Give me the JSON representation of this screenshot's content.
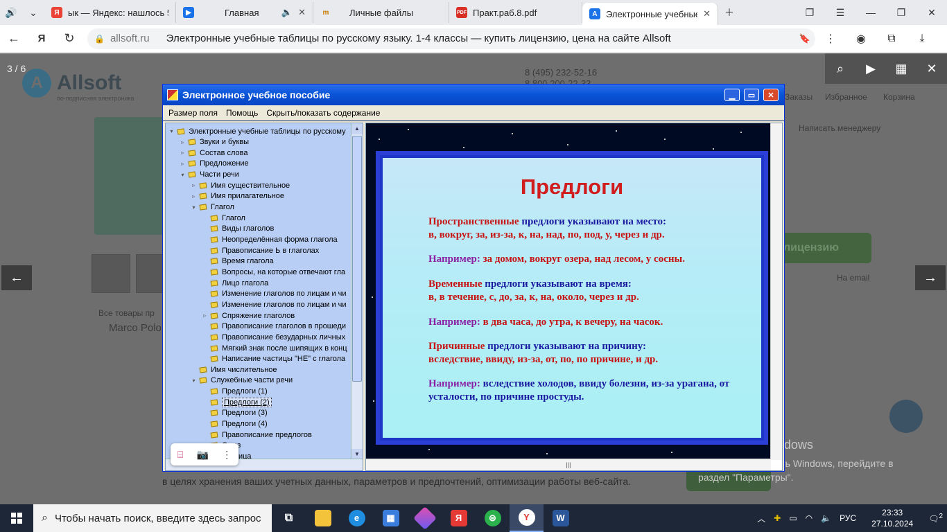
{
  "browser": {
    "tabs": [
      {
        "title": "ык — Яндекс: нашлось 5 т",
        "favicon": "yandex-icon",
        "color": "#ea4335"
      },
      {
        "title": "Главная",
        "favicon": "play-icon",
        "color": "#1a73e8"
      },
      {
        "title": "Личные файлы",
        "favicon": "files-icon",
        "color": "#f4a21a"
      },
      {
        "title": "Практ.раб.8.pdf",
        "favicon": "pdf-icon",
        "color": "#d93025"
      },
      {
        "title": "Электронные учебные",
        "favicon": "allsoft-icon",
        "color": "#1a73e8"
      }
    ],
    "address": {
      "domain": "allsoft.ru",
      "page_title": "Электронные учебные таблицы по русскому языку. 1-4 классы — купить лицензию, цена на сайте Allsoft"
    }
  },
  "background_page": {
    "counter": "3 / 6",
    "logo": "Allsoft",
    "logo_sub": "по-подписная электроника",
    "phone": "8 (495) 232-52-16",
    "phone2": "8 800 200-22-33",
    "top_links": [
      "Заказы",
      "Избранное",
      "Корзина"
    ],
    "write_manager": "Написать менеджеру",
    "buy_button": "лицензию",
    "by_email": "На email",
    "all_products": "Все товары пр",
    "vendor": "Marco Polo",
    "cookie_text": "в целях хранения ваших учетных данных, параметров и предпочтений, оптимизации работы веб-сайта."
  },
  "app": {
    "title": "Электронное учебное пособие",
    "menu": [
      "Размер поля",
      "Помощь",
      "Скрыть/показать содержание"
    ],
    "tree": [
      {
        "label": "Электронные учебные таблицы по русскому",
        "level": 0,
        "exp": "▾"
      },
      {
        "label": "Звуки и буквы",
        "level": 1,
        "exp": "▹"
      },
      {
        "label": "Состав слова",
        "level": 1,
        "exp": "▹"
      },
      {
        "label": "Предложение",
        "level": 1,
        "exp": "▹"
      },
      {
        "label": "Части речи",
        "level": 1,
        "exp": "▾"
      },
      {
        "label": "Имя существительное",
        "level": 2,
        "exp": "▹"
      },
      {
        "label": "Имя прилагательное",
        "level": 2,
        "exp": "▹"
      },
      {
        "label": "Глагол",
        "level": 2,
        "exp": "▾"
      },
      {
        "label": "Глагол",
        "level": 3,
        "exp": ""
      },
      {
        "label": "Виды глаголов",
        "level": 3,
        "exp": ""
      },
      {
        "label": "Неопределённая форма глагола",
        "level": 3,
        "exp": ""
      },
      {
        "label": "Правописание Ь в глаголах",
        "level": 3,
        "exp": ""
      },
      {
        "label": "Время глагола",
        "level": 3,
        "exp": ""
      },
      {
        "label": "Вопросы, на которые отвечают гла",
        "level": 3,
        "exp": ""
      },
      {
        "label": "Лицо глагола",
        "level": 3,
        "exp": ""
      },
      {
        "label": "Изменение глаголов по лицам и чи",
        "level": 3,
        "exp": ""
      },
      {
        "label": "Изменение глаголов по лицам и чи",
        "level": 3,
        "exp": ""
      },
      {
        "label": "Спряжение глаголов",
        "level": 3,
        "exp": "▹"
      },
      {
        "label": "Правописание глаголов в прошеди",
        "level": 3,
        "exp": ""
      },
      {
        "label": "Правописание безударных личных",
        "level": 3,
        "exp": ""
      },
      {
        "label": "Мягкий знак после шипящих в конц",
        "level": 3,
        "exp": ""
      },
      {
        "label": "Написание частицы \"НЕ\" с глагола",
        "level": 3,
        "exp": ""
      },
      {
        "label": "Имя числительное",
        "level": 2,
        "exp": ""
      },
      {
        "label": "Служебные части речи",
        "level": 2,
        "exp": "▾"
      },
      {
        "label": "Предлоги (1)",
        "level": 3,
        "exp": ""
      },
      {
        "label": "Предлоги (2)",
        "level": 3,
        "exp": "",
        "selected": true
      },
      {
        "label": "Предлоги (3)",
        "level": 3,
        "exp": ""
      },
      {
        "label": "Предлоги (4)",
        "level": 3,
        "exp": ""
      },
      {
        "label": "Правописание предлогов",
        "level": 3,
        "exp": ""
      },
      {
        "label": "Союз",
        "level": 3,
        "exp": ""
      },
      {
        "label": "Частица",
        "level": 3,
        "exp": ""
      }
    ],
    "slide": {
      "title": "Предлоги",
      "p1_a": "Пространственные",
      "p1_b": " предлоги указывают на место:",
      "p1_list": "в, вокруг, за, из-за, к, на, над, по, под, у, через и др.",
      "e1_label": "Например:",
      "e1": " за домом, вокруг озера, над лесом, у сосны.",
      "p2_a": "Временные",
      "p2_b": " предлоги указывают на время:",
      "p2_list": "в, в течение, с, до, за, к, на, около, через и др.",
      "e2_label": "Например:",
      "e2": " в два часа, до утра, к вечеру, на часок.",
      "p3_a": "Причинные",
      "p3_b": " предлоги указывают на причину:",
      "p3_list": "вследствие, ввиду, из-за, от, по, по причине, и др.",
      "e3_label": "Например:",
      "e3": " вследствие холодов, ввиду болезни, из-за урагана, от усталости, по причине простуды."
    }
  },
  "activation": {
    "title": "Активация Windows",
    "text": "Чтобы активировать Windows, перейдите в раздел \"Параметры\"."
  },
  "taskbar": {
    "search_placeholder": "Чтобы начать поиск, введите здесь запрос",
    "lang": "РУС",
    "time": "23:33",
    "date": "27.10.2024",
    "notifications": "2"
  }
}
